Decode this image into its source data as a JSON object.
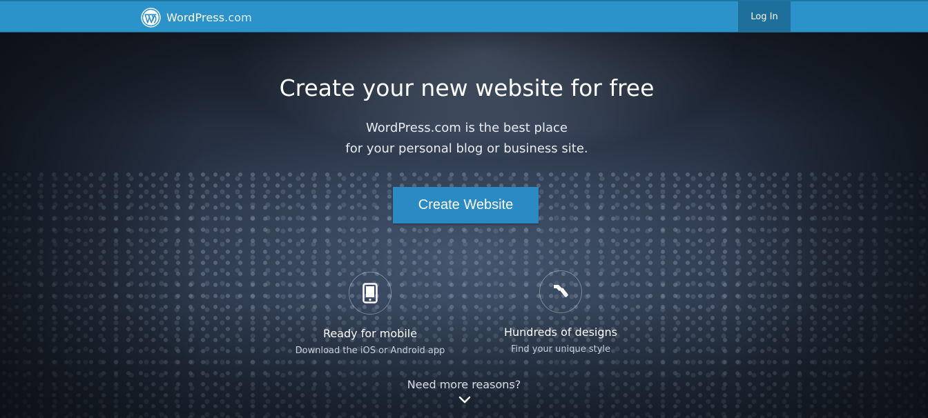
{
  "header": {
    "brand": "WordPress",
    "brand_suffix": ".com",
    "login_label": "Log In",
    "brand_color": "#2b93c9",
    "login_bg": "#1f6f9c"
  },
  "hero": {
    "headline": "Create your new website for free",
    "subline_1": "WordPress.com is the best place",
    "subline_2": "for your personal blog or business site.",
    "cta_label": "Create Website",
    "cta_color": "#2a8ac4"
  },
  "features": [
    {
      "icon": "mobile-phone-icon",
      "title": "Ready for mobile",
      "subtitle": "Download the iOS or Android app"
    },
    {
      "icon": "paintbrush-icon",
      "title": "Hundreds of designs",
      "subtitle": "Find your unique style"
    }
  ],
  "more_reasons": {
    "label": "Need more reasons?",
    "icon": "chevron-down-icon"
  }
}
